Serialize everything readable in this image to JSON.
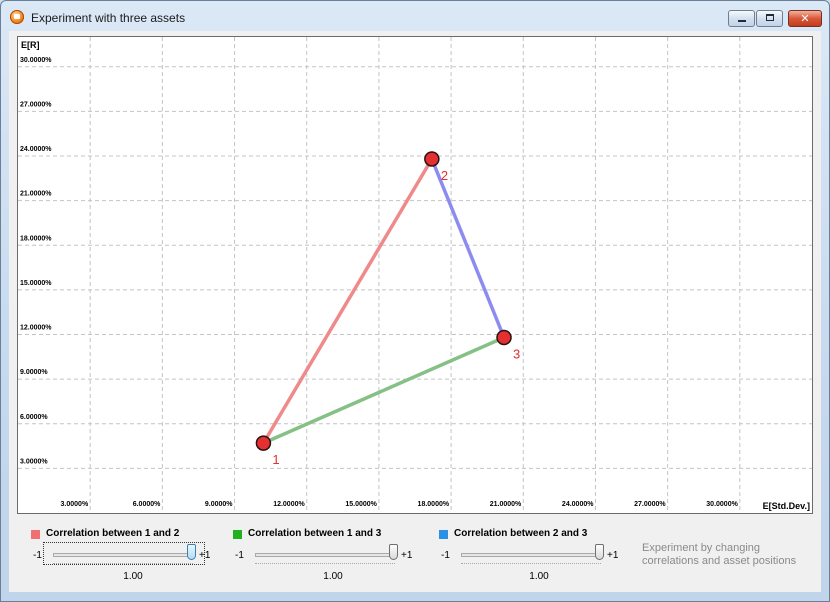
{
  "window": {
    "title": "Experiment with three assets",
    "min_glyph": "",
    "max_glyph": "",
    "close_glyph": "✕"
  },
  "chart_data": {
    "type": "scatter",
    "xlabel": "E[Std.Dev.]",
    "ylabel": "E[R]",
    "xlim": [
      0,
      33
    ],
    "ylim": [
      0,
      32
    ],
    "x_ticks": [
      3,
      6,
      9,
      12,
      15,
      18,
      21,
      24,
      27,
      30
    ],
    "x_tick_labels": [
      "3.0000%",
      "6.0000%",
      "9.0000%",
      "12.0000%",
      "15.0000%",
      "18.0000%",
      "21.0000%",
      "24.0000%",
      "27.0000%",
      "30.0000%"
    ],
    "y_ticks": [
      3,
      6,
      9,
      12,
      15,
      18,
      21,
      24,
      27,
      30
    ],
    "y_tick_labels": [
      "3.0000%",
      "6.0000%",
      "9.0000%",
      "12.0000%",
      "15.0000%",
      "18.0000%",
      "21.0000%",
      "24.0000%",
      "27.0000%",
      "30.0000%"
    ],
    "grid": true,
    "points": [
      {
        "label": "1",
        "x": 10.2,
        "y": 4.7
      },
      {
        "label": "2",
        "x": 17.2,
        "y": 23.8
      },
      {
        "label": "3",
        "x": 20.2,
        "y": 11.8
      }
    ],
    "segments": [
      {
        "from": 0,
        "to": 1,
        "color": "#f08a8a"
      },
      {
        "from": 1,
        "to": 2,
        "color": "#8c8cf0"
      },
      {
        "from": 0,
        "to": 2,
        "color": "#85c085"
      }
    ],
    "colors": {
      "point_fill": "#e33030",
      "point_stroke": "#2a1010",
      "point_label": "#e33030"
    }
  },
  "controls": {
    "corr12": {
      "label": "Correlation between 1 and 2",
      "color": "#f07070",
      "min": "-1",
      "max": "+1",
      "value": "1.00",
      "position": 1.0
    },
    "corr13": {
      "label": "Correlation between 1 and 3",
      "color": "#20b020",
      "min": "-1",
      "max": "+1",
      "value": "1.00",
      "position": 1.0
    },
    "corr23": {
      "label": "Correlation between 2 and 3",
      "color": "#2b8fe6",
      "min": "-1",
      "max": "+1",
      "value": "1.00",
      "position": 1.0
    },
    "hint": "Experiment by changing correlations and asset positions"
  }
}
